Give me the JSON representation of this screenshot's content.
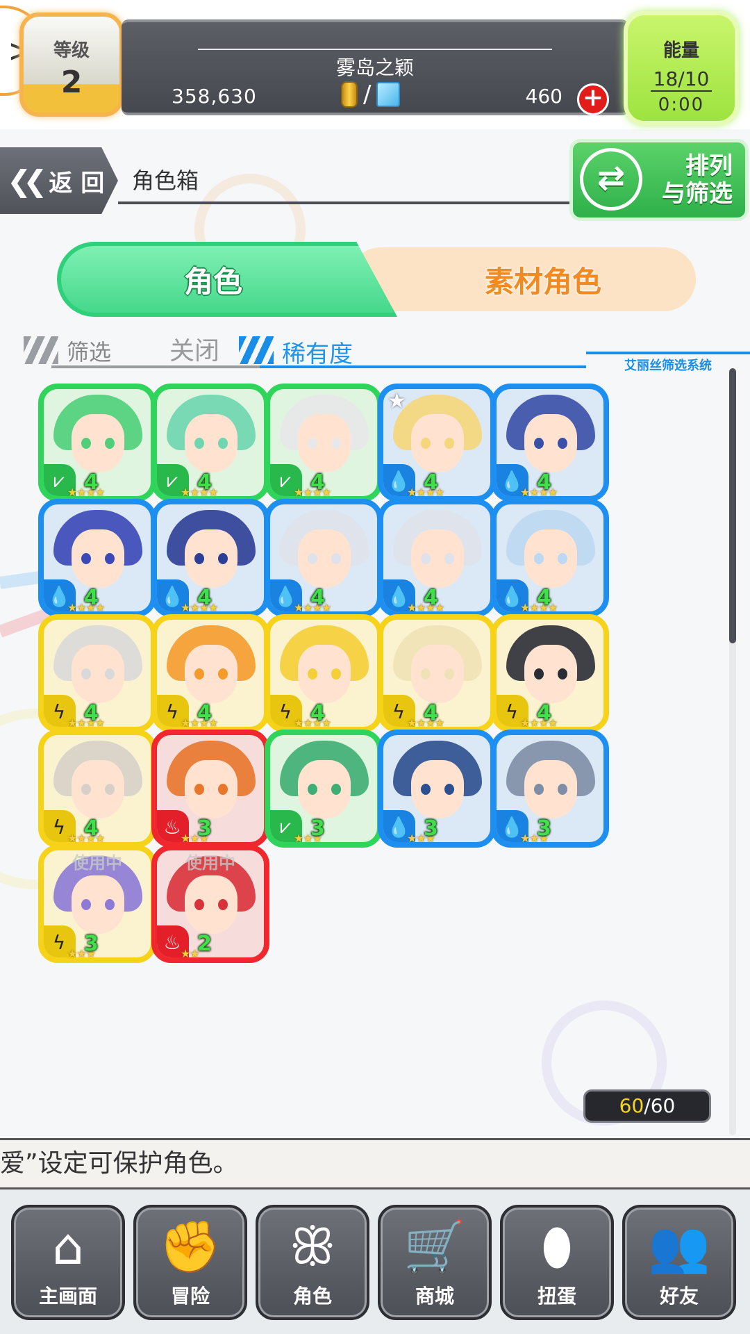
{
  "header": {
    "level_label": "等级",
    "level_value": "2",
    "player_name": "雾岛之颖",
    "gold": "358,630",
    "currency_separator": "/",
    "gems": "460",
    "energy_label": "能量",
    "energy_value": "18/10",
    "energy_timer": "0:00"
  },
  "nav": {
    "back_label": "返 回",
    "page_title": "角色箱",
    "sort_filter_label": "排列\n与筛选"
  },
  "tabs": {
    "characters": "角色",
    "material_characters": "素材角色"
  },
  "filter": {
    "label": "筛选",
    "state": "关闭",
    "sort_label": "稀有度",
    "system_label": "艾丽丝筛选系统"
  },
  "characters": [
    {
      "element": "wind",
      "color": "green",
      "level": "4",
      "stars": "★★★★",
      "hair": "#4fcf7a"
    },
    {
      "element": "wind",
      "color": "green",
      "level": "4",
      "stars": "★★★★",
      "hair": "#6fd6b0"
    },
    {
      "element": "wind",
      "color": "green",
      "level": "4",
      "stars": "★★★★",
      "hair": "#e8e8ea"
    },
    {
      "element": "water",
      "color": "blue",
      "level": "4",
      "stars": "★★★★",
      "hair": "#f5d67a",
      "favorite": true
    },
    {
      "element": "water",
      "color": "blue",
      "level": "4",
      "stars": "★★★★",
      "hair": "#3a4fa8"
    },
    {
      "element": "water",
      "color": "blue",
      "level": "4",
      "stars": "★★★★",
      "hair": "#3a48b8"
    },
    {
      "element": "water",
      "color": "blue",
      "level": "4",
      "stars": "★★★★",
      "hair": "#2d3e96"
    },
    {
      "element": "water",
      "color": "blue",
      "level": "4",
      "stars": "★★★★",
      "hair": "#dfe2ea"
    },
    {
      "element": "water",
      "color": "blue",
      "level": "4",
      "stars": "★★★★",
      "hair": "#dfe2ea"
    },
    {
      "element": "water",
      "color": "blue",
      "level": "4",
      "stars": "★★★★",
      "hair": "#bcd8f2"
    },
    {
      "element": "thunder",
      "color": "yellow",
      "level": "4",
      "stars": "★★★★",
      "hair": "#d9d9d9"
    },
    {
      "element": "thunder",
      "color": "yellow",
      "level": "4",
      "stars": "★★★★",
      "hair": "#f59b2c"
    },
    {
      "element": "thunder",
      "color": "yellow",
      "level": "4",
      "stars": "★★★★",
      "hair": "#f5cf36"
    },
    {
      "element": "thunder",
      "color": "yellow",
      "level": "4",
      "stars": "★★★★",
      "hair": "#efe2b6"
    },
    {
      "element": "thunder",
      "color": "yellow",
      "level": "4",
      "stars": "★★★★",
      "hair": "#2b2d36"
    },
    {
      "element": "thunder",
      "color": "yellow",
      "level": "4",
      "stars": "★★★★",
      "hair": "#d6d0c8"
    },
    {
      "element": "fire",
      "color": "red",
      "level": "3",
      "stars": "★★★",
      "hair": "#e8762c"
    },
    {
      "element": "wind",
      "color": "green",
      "level": "3",
      "stars": "★★★",
      "hair": "#3fae74"
    },
    {
      "element": "water",
      "color": "blue",
      "level": "3",
      "stars": "★★★",
      "hair": "#2b4f8f"
    },
    {
      "element": "water",
      "color": "blue",
      "level": "3",
      "stars": "★★★",
      "hair": "#7e8ea6"
    },
    {
      "element": "thunder",
      "color": "yellow",
      "level": "3",
      "stars": "★★★",
      "hair": "#8c7ad6",
      "in_use": "使用中"
    },
    {
      "element": "fire",
      "color": "red",
      "level": "2",
      "stars": "★★",
      "hair": "#d8323a",
      "in_use": "使用中"
    }
  ],
  "capacity": {
    "current": "60",
    "separator": "/",
    "max": "60"
  },
  "hint": "爱”设定可保护角色。",
  "bottom_nav": [
    {
      "label": "主画面",
      "icon": "home-icon",
      "glyph": "⌂"
    },
    {
      "label": "冒险",
      "icon": "handshake-icon",
      "glyph": "✊"
    },
    {
      "label": "角色",
      "icon": "rabbit-icon",
      "glyph": "ꕥ"
    },
    {
      "label": "商城",
      "icon": "cart-icon",
      "glyph": "🛒"
    },
    {
      "label": "扭蛋",
      "icon": "egg-icon",
      "glyph": "⬮"
    },
    {
      "label": "好友",
      "icon": "friends-icon",
      "glyph": "👥"
    }
  ],
  "colors": {
    "green": "#2fd45b",
    "blue": "#1c8ff0",
    "yellow": "#f6d318",
    "red": "#f0282e",
    "energy": "#9de33f",
    "level_border": "#f7b34d"
  }
}
